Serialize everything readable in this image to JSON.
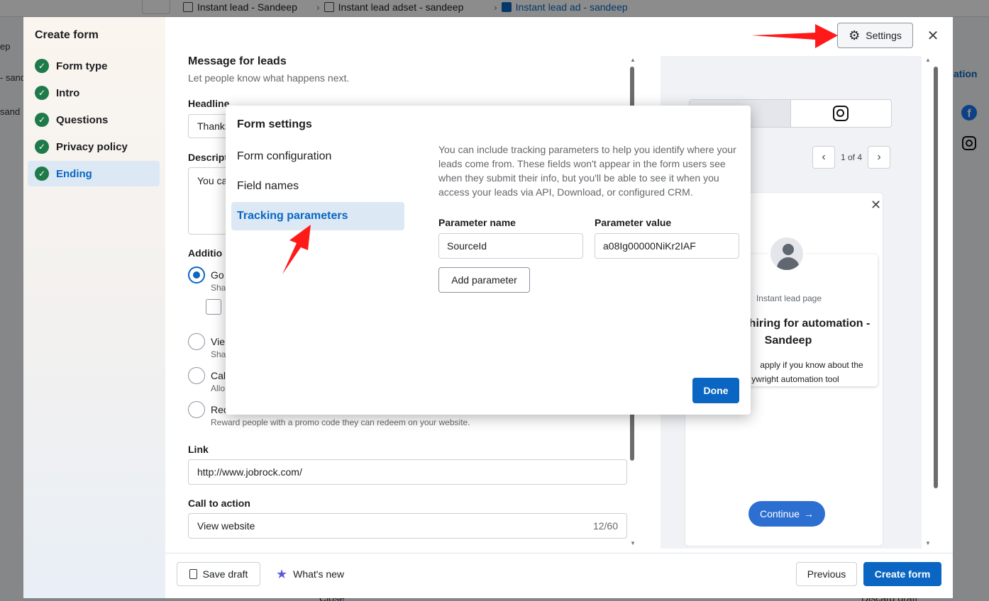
{
  "background": {
    "breadcrumbs": [
      "Instant lead - Sandeep",
      "Instant lead adset - sandeep",
      "Instant lead ad - sandeep"
    ],
    "left_fragments": [
      "ep",
      "- sand",
      "sand"
    ],
    "right_link": "ation",
    "bottom_left": "Close",
    "bottom_right": "Discard draft"
  },
  "create_form": {
    "title": "Create form",
    "steps": [
      {
        "label": "Form type"
      },
      {
        "label": "Intro"
      },
      {
        "label": "Questions"
      },
      {
        "label": "Privacy policy"
      },
      {
        "label": "Ending",
        "active": true
      }
    ],
    "settings_label": "Settings",
    "main": {
      "section_title": "Message for leads",
      "section_sub": "Let people know what happens next.",
      "headline_label": "Headline",
      "headline_value": "Thanks",
      "description_label": "Descript",
      "description_value": "You ca",
      "additional_label": "Additio",
      "options": [
        {
          "title": "Go",
          "sub": "Sha",
          "selected": true
        },
        {
          "title": "Vie",
          "sub": "Sha",
          "selected": false
        },
        {
          "title": "Cal",
          "sub": "Allo",
          "selected": false
        },
        {
          "title": "Rec",
          "sub": "Reward people with a promo code they can redeem on your website.",
          "selected": false
        }
      ],
      "link_label": "Link",
      "link_value": "http://www.jobrock.com/",
      "cta_label": "Call to action",
      "cta_value": "View website",
      "cta_count": "12/60"
    },
    "preview": {
      "pager": "1 of 4",
      "page_type": "Instant lead page",
      "heading_line1": "hiring for automation -",
      "heading_line2": "Sandeep",
      "body_line1": "apply if you know about the",
      "body_line2": "ywright automation tool",
      "continue_label": "Continue"
    },
    "footer": {
      "save_draft": "Save draft",
      "whats_new": "What's new",
      "previous": "Previous",
      "create": "Create form"
    }
  },
  "modal": {
    "title": "Form settings",
    "nav": [
      {
        "label": "Form configuration"
      },
      {
        "label": "Field names"
      },
      {
        "label": "Tracking parameters",
        "active": true
      }
    ],
    "description": "You can include tracking parameters to help you identify where your leads come from. These fields won't appear in the form users see when they submit their info, but you'll be able to see it when you access your leads via API, Download, or configured CRM.",
    "param_name_label": "Parameter name",
    "param_value_label": "Parameter value",
    "param_name_value": "SourceId",
    "param_value_value": "a08Ig00000NiKr2IAF",
    "add_parameter": "Add parameter",
    "done": "Done"
  },
  "colors": {
    "accent": "#0a66c2",
    "check": "#1f7a4a",
    "annotation_arrow": "#ff1a1a"
  },
  "icons": [
    "gear-icon",
    "close-icon",
    "check-icon",
    "facebook-icon",
    "instagram-icon",
    "document-icon",
    "star-icon",
    "chevron-left-icon",
    "chevron-right-icon",
    "arrow-right-icon"
  ]
}
